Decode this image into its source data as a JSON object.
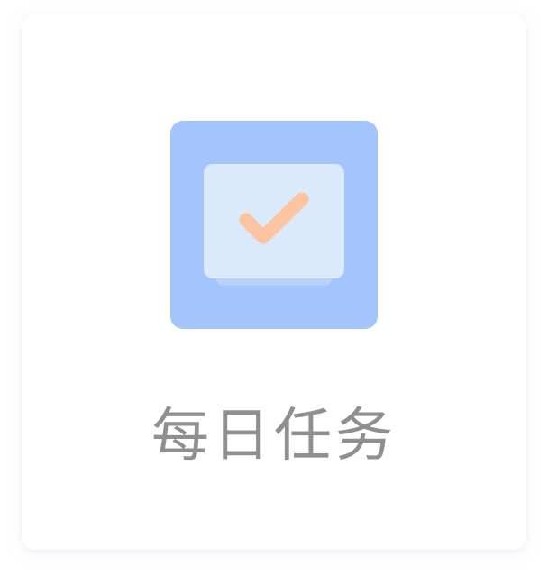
{
  "task_card": {
    "label": "每日任务",
    "icon": "daily-task-checkmark-icon",
    "colors": {
      "tile_background": "#a3c4fc",
      "inner_panel": "#dbeafb",
      "panel_stack": "#b9d1f6",
      "check_mark": "#fcc4a1",
      "label_text": "#8f8f8f"
    }
  }
}
